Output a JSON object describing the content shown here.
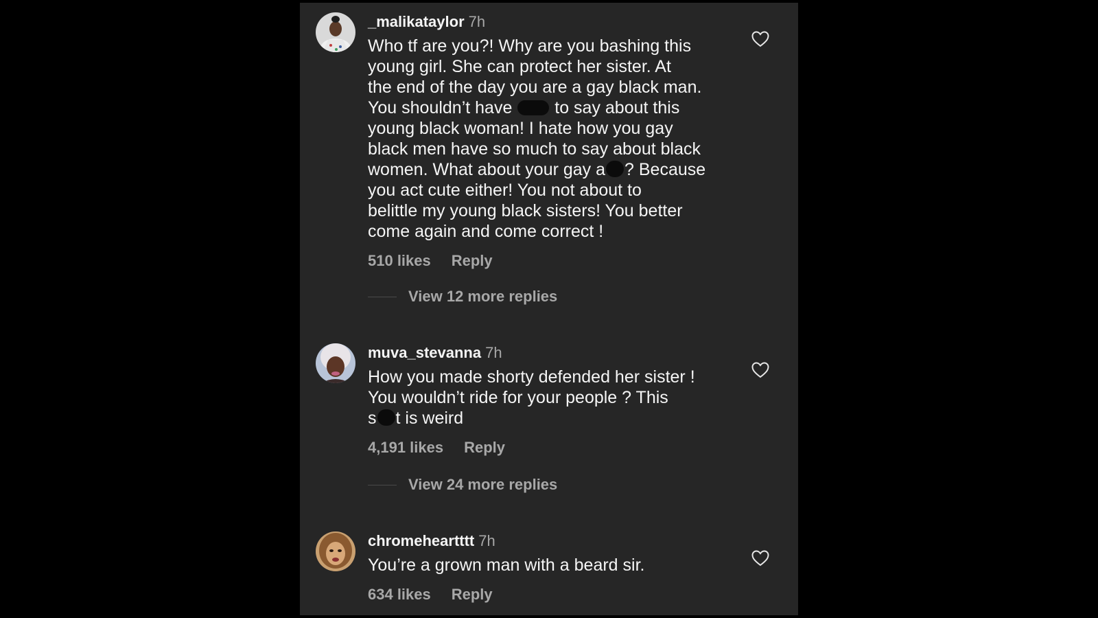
{
  "comments": [
    {
      "username": "_malikataylor",
      "time": "7h",
      "text_parts": [
        "Who tf are you?! Why are you bashing this\nyoung girl. She can protect her sister. At\nthe end of the day you are a gay black man.\nYou shouldn’t have ",
        " to say about this\nyoung black woman! I hate how you gay\nblack men have so much to say about black\nwomen. What about your gay a",
        "? Because\nyou act cute either! You not about to\nbelittle my young black sisters! You better\ncome again and come correct !"
      ],
      "likes": "510 likes",
      "reply": "Reply",
      "view_replies": "View 12 more replies"
    },
    {
      "username": "muva_stevanna",
      "time": "7h",
      "text_parts": [
        "How you made shorty defended her sister !\nYou wouldn’t ride for your people ? This\ns",
        "t is weird"
      ],
      "likes": "4,191 likes",
      "reply": "Reply",
      "view_replies": "View 24 more replies"
    },
    {
      "username": "chromeheartttt",
      "time": "7h",
      "text": "You’re a grown man with a beard sir.",
      "likes": "634 likes",
      "reply": "Reply"
    }
  ],
  "icons": {
    "like": "heart-outline-icon"
  },
  "colors": {
    "background": "#000000",
    "panel": "#262626",
    "primary_text": "#f5f5f5",
    "secondary_text": "#a8a8a8"
  }
}
